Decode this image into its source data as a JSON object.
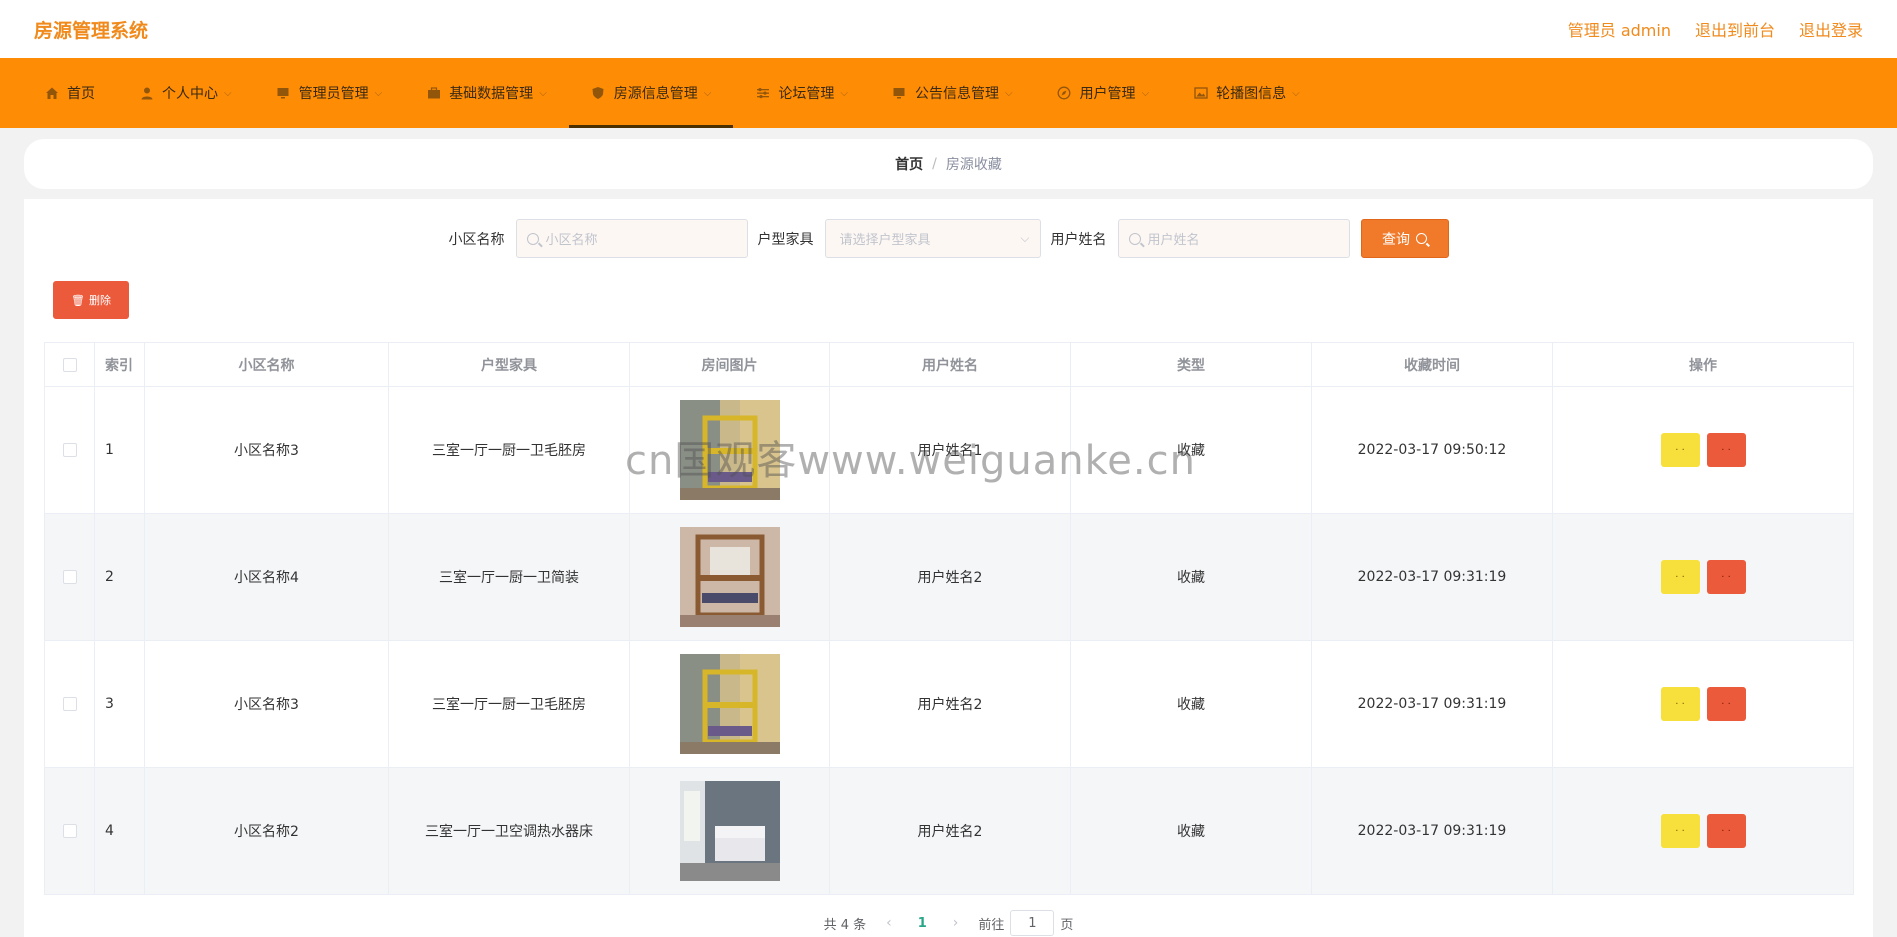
{
  "header": {
    "brand": "房源管理系统",
    "admin_label": "管理员 admin",
    "to_front": "退出到前台",
    "logout": "退出登录"
  },
  "nav": {
    "items": [
      {
        "label": "首页",
        "icon": "home-icon"
      },
      {
        "label": "个人中心",
        "icon": "user-icon"
      },
      {
        "label": "管理员管理",
        "icon": "monitor-icon"
      },
      {
        "label": "基础数据管理",
        "icon": "briefcase-icon"
      },
      {
        "label": "房源信息管理",
        "icon": "shield-icon"
      },
      {
        "label": "论坛管理",
        "icon": "sliders-icon"
      },
      {
        "label": "公告信息管理",
        "icon": "monitor-icon"
      },
      {
        "label": "用户管理",
        "icon": "compass-icon"
      },
      {
        "label": "轮播图信息",
        "icon": "image-icon"
      }
    ]
  },
  "breadcrumb": {
    "home": "首页",
    "separator": "/",
    "current": "房源收藏"
  },
  "search": {
    "community_label": "小区名称",
    "community_placeholder": "小区名称",
    "layout_label": "户型家具",
    "layout_placeholder": "请选择户型家具",
    "username_label": "用户姓名",
    "username_placeholder": "用户姓名",
    "query_button": "查询"
  },
  "toolbar": {
    "delete_label": "删除"
  },
  "table": {
    "headers": [
      "索引",
      "小区名称",
      "户型家具",
      "房间图片",
      "用户姓名",
      "类型",
      "收藏时间",
      "操作"
    ],
    "rows": [
      {
        "index": "1",
        "community": "小区名称3",
        "layout": "三室一厅一厨一卫毛胚房",
        "username": "用户姓名1",
        "type": "收藏",
        "time": "2022-03-17 09:50:12",
        "image": "bunk-bed-yellow"
      },
      {
        "index": "2",
        "community": "小区名称4",
        "layout": "三室一厅一厨一卫简装",
        "username": "用户姓名2",
        "type": "收藏",
        "time": "2022-03-17 09:31:19",
        "image": "bunk-bed-wood"
      },
      {
        "index": "3",
        "community": "小区名称3",
        "layout": "三室一厅一厨一卫毛胚房",
        "username": "用户姓名2",
        "type": "收藏",
        "time": "2022-03-17 09:31:19",
        "image": "bunk-bed-yellow"
      },
      {
        "index": "4",
        "community": "小区名称2",
        "layout": "三室一厅一卫空调热水器床",
        "username": "用户姓名2",
        "type": "收藏",
        "time": "2022-03-17 09:31:19",
        "image": "bedroom-grey"
      }
    ]
  },
  "pagination": {
    "total_text": "共 4 条",
    "current_page": "1",
    "goto_label": "前往",
    "goto_value": "1",
    "page_suffix": "页"
  },
  "watermark": "cn国观客www.weiguanke.cn",
  "colors": {
    "brand": "#f08a1c",
    "nav_bg": "#ff8c05",
    "query_button": "#f07a2a",
    "delete_button": "#ec5a3c",
    "edit_button": "#f7e03c",
    "page_active": "#29a68a"
  }
}
